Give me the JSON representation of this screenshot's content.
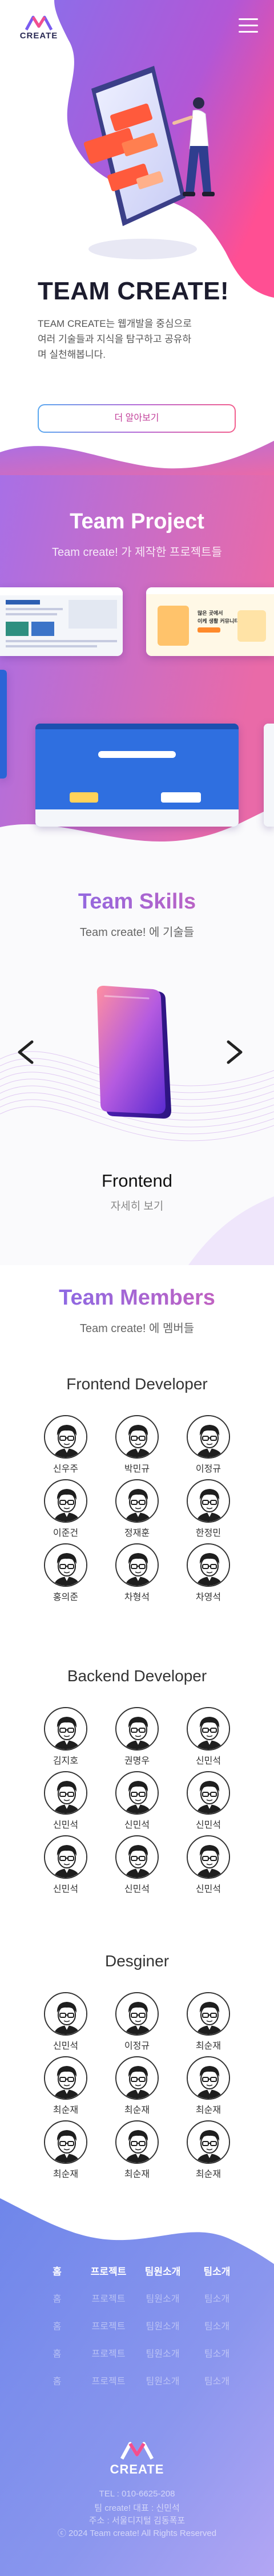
{
  "header": {
    "logo_text": "CREATE",
    "menu_icon": "hamburger-menu-icon"
  },
  "hero": {
    "title": "TEAM CREATE!",
    "desc_line1": "TEAM CREATE는 웹개발을 중심으로",
    "desc_line2": "여러 기술들과 지식을 탐구하고 공유하",
    "desc_line3": "며 실천해봅니다.",
    "button_label": "더 알아보기"
  },
  "project": {
    "title": "Team Project",
    "subtitle": "Team create! 가 제작한 프로젝트들",
    "thumb2_line1": "많은 곳에서",
    "thumb2_line2": "이케 생활 커뮤니티!"
  },
  "skills": {
    "title": "Team Skills",
    "subtitle": "Team create! 에 기술들",
    "skill_name": "Frontend",
    "more_label": "자세히 보기",
    "prev_icon": "chevron-left-icon",
    "next_icon": "chevron-right-icon"
  },
  "members": {
    "title": "Team Members",
    "subtitle": "Team create! 에 멤버들",
    "groups": [
      {
        "title": "Frontend Developer",
        "names": [
          "신우주",
          "박민규",
          "이정규",
          "이준건",
          "정재훈",
          "한정민",
          "홍의준",
          "차형석",
          "차영석"
        ]
      },
      {
        "title": "Backend Developer",
        "names": [
          "김지호",
          "권명우",
          "신민석",
          "신민석",
          "신민석",
          "신민석",
          "신민석",
          "신민석",
          "신민석"
        ]
      },
      {
        "title": "Desginer",
        "names": [
          "신민석",
          "이정규",
          "최순재",
          "최순재",
          "최순재",
          "최순재",
          "최순재",
          "최순재",
          "최순재"
        ]
      }
    ]
  },
  "footer": {
    "columns": [
      {
        "head": "홈",
        "items": [
          "홈",
          "홈",
          "홈",
          "홈"
        ]
      },
      {
        "head": "프로젝트",
        "items": [
          "프로젝트",
          "프로젝트",
          "프로젝트",
          "프로젝트"
        ]
      },
      {
        "head": "팀원소개",
        "items": [
          "팀원소개",
          "팀원소개",
          "팀원소개",
          "팀원소개"
        ]
      },
      {
        "head": "팀소개",
        "items": [
          "팀소개",
          "팀소개",
          "팀소개",
          "팀소개"
        ]
      }
    ],
    "logo_text": "CREATE",
    "tel": "TEL : 010-6625-208",
    "representative": "팀 create! 대표 : 신민석",
    "address": "주소 : 서울디지털 김동폭포",
    "copyright": "ⓒ 2024 Team create! All Rights Reserved"
  },
  "colors": {
    "brand_purple": "#8a63e0",
    "brand_pink": "#e65aa8",
    "brand_blue": "#6fa4ee",
    "text_dark": "#1c1c2e"
  }
}
